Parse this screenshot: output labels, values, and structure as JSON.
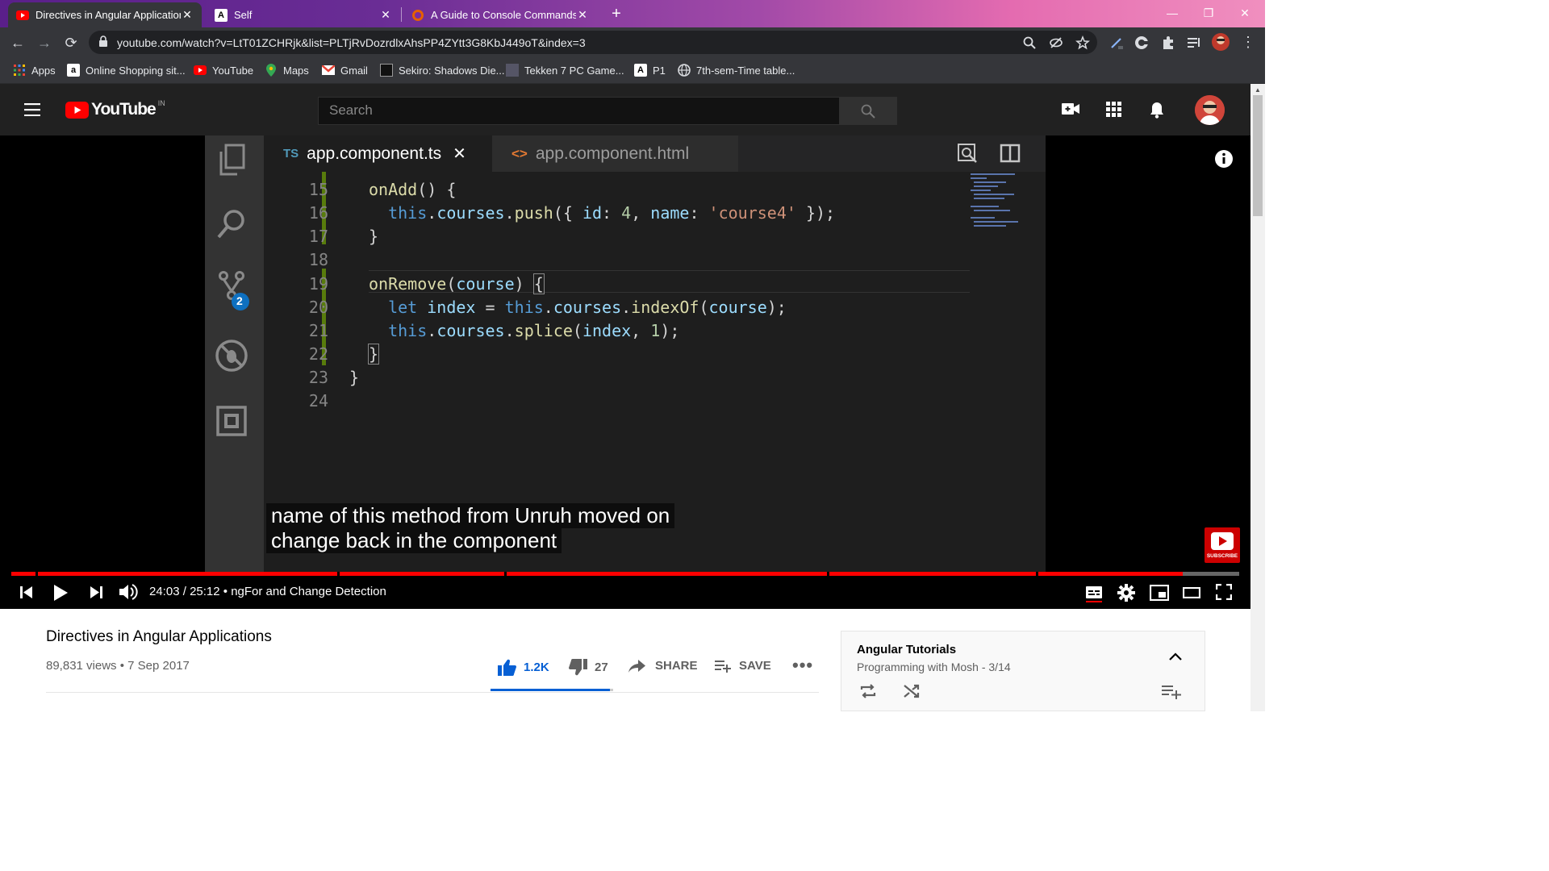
{
  "browser": {
    "tabs": [
      {
        "title": "Directives in Angular Application",
        "favicon": "youtube-icon"
      },
      {
        "title": "Self",
        "favicon": "angular-icon"
      },
      {
        "title": "A Guide to Console Commands |",
        "favicon": "firefox-icon"
      }
    ],
    "url": "youtube.com/watch?v=LtT01ZCHRjk&list=PLTjRvDozrdlxAhsPP4ZYtt3G8KbJ449oT&index=3",
    "bookmarks": [
      {
        "label": "Apps",
        "icon": "apps-grid-icon"
      },
      {
        "label": "Online Shopping sit...",
        "icon": "amazon-icon"
      },
      {
        "label": "YouTube",
        "icon": "youtube-icon"
      },
      {
        "label": "Maps",
        "icon": "maps-pin-icon"
      },
      {
        "label": "Gmail",
        "icon": "gmail-icon"
      },
      {
        "label": "Sekiro: Shadows Die...",
        "icon": "sekiro-icon"
      },
      {
        "label": "Tekken 7 PC Game...",
        "icon": "tekken-icon"
      },
      {
        "label": "P1",
        "icon": "angular-icon"
      },
      {
        "label": "7th-sem-Time table...",
        "icon": "globe-icon"
      }
    ]
  },
  "youtube": {
    "logo_text": "YouTube",
    "country_code": "IN",
    "search_placeholder": "Search"
  },
  "vscode": {
    "tabs": [
      {
        "badge": "TS",
        "name": "app.component.ts",
        "active": true
      },
      {
        "badge": "<>",
        "name": "app.component.html",
        "active": false
      }
    ],
    "scm_badge": "2",
    "lines": [
      {
        "n": "15",
        "code": "onAdd() {"
      },
      {
        "n": "16",
        "code": "this.courses.push({ id: 4, name: 'course4' });"
      },
      {
        "n": "17",
        "code": "}"
      },
      {
        "n": "18",
        "code": ""
      },
      {
        "n": "19",
        "code": "onRemove(course) {"
      },
      {
        "n": "20",
        "code": "let index = this.courses.indexOf(course);"
      },
      {
        "n": "21",
        "code": "this.courses.splice(index, 1);"
      },
      {
        "n": "22",
        "code": "}"
      },
      {
        "n": "23",
        "code": "}"
      },
      {
        "n": "24",
        "code": ""
      }
    ]
  },
  "player": {
    "captions": [
      "name of this method from Unruh moved on",
      "change back in the component"
    ],
    "current_time": "24:03",
    "duration": "25:12",
    "chapter": "ngFor and Change Detection",
    "subscribe_label": "SUBSCRIBE",
    "progress_fraction": 0.954
  },
  "video": {
    "title": "Directives in Angular Applications",
    "views": "89,831 views",
    "date": "7 Sep 2017",
    "likes": "1.2K",
    "dislikes": "27",
    "share_label": "SHARE",
    "save_label": "SAVE"
  },
  "playlist": {
    "title": "Angular Tutorials",
    "channel": "Programming with Mosh",
    "position": "3/14"
  }
}
